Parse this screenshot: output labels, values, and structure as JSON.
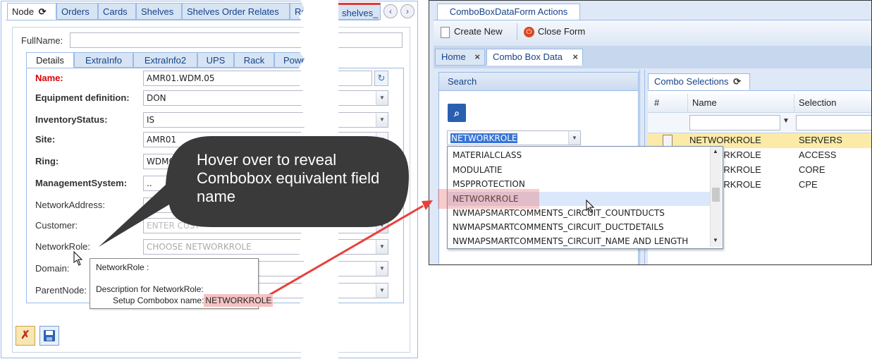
{
  "top_tabs": [
    "Node",
    "Orders",
    "Cards",
    "Shelves",
    "Shelves Order Relates",
    "Re",
    "shelves_"
  ],
  "fullname": {
    "label": "FullName:",
    "value": ""
  },
  "sub_tabs": [
    "Details",
    "ExtraInfo",
    "ExtraInfo2",
    "UPS",
    "Rack",
    "Powe"
  ],
  "fields": [
    {
      "label": "Name:",
      "value": "AMR01.WDM.05"
    },
    {
      "label": "Equipment definition:",
      "value": "DON"
    },
    {
      "label": "InventoryStatus:",
      "value": "IS"
    },
    {
      "label": "Site:",
      "value": "AMR01"
    },
    {
      "label": "Ring:",
      "value": "WDM0"
    },
    {
      "label": "ManagementSystem:",
      "value": ".."
    },
    {
      "label": "NetworkAddress:",
      "value": ""
    },
    {
      "label": "Customer:",
      "value": "ENTER CUST"
    },
    {
      "label": "NetworkRole:",
      "value": "",
      "placeholder": "CHOOSE NETWORKROLE"
    },
    {
      "label": "Domain:",
      "value": ""
    },
    {
      "label": "ParentNode:",
      "value": ""
    }
  ],
  "callout": {
    "text": "Hover over to reveal Combobox equivalent field name"
  },
  "tooltip": {
    "line1": "NetworkRole :",
    "line2": "Description for NetworkRole:",
    "line3_prefix": "Setup Combobox name:",
    "line3_value": "NETWORKROLE"
  },
  "right": {
    "actions_tab": "ComboBoxDataForm Actions",
    "create_new": "Create New",
    "close_form": "Close Form",
    "tabs": [
      "Home",
      "Combo Box Data"
    ],
    "search_title": "Search",
    "combo_value": "NETWORKROLE",
    "dropdown_items": [
      "MATERIALCLASS",
      "MODULATIE",
      "MSPPROTECTION",
      "NETWORKROLE",
      "NWMAPSMARTCOMMENTS_CIRCUIT_COUNTDUCTS",
      "NWMAPSMARTCOMMENTS_CIRCUIT_DUCTDETAILS",
      "NWMAPSMARTCOMMENTS_CIRCUIT_NAME AND LENGTH"
    ],
    "selections_tab": "Combo Selections",
    "columns": [
      "#",
      "Name",
      "Selection"
    ],
    "rows": [
      {
        "name": "NETWORKROLE",
        "selection": "SERVERS"
      },
      {
        "name": "NETWORKROLE",
        "selection": "ACCESS"
      },
      {
        "name": "NETWORKROLE",
        "selection": "CORE"
      },
      {
        "name": "NETWORKROLE",
        "selection": "CPE"
      }
    ]
  },
  "colors": {
    "callout": "#3a3a3a",
    "arrow": "#e8403c",
    "highlight": "#f5c2c2",
    "accent": "#15428b"
  }
}
